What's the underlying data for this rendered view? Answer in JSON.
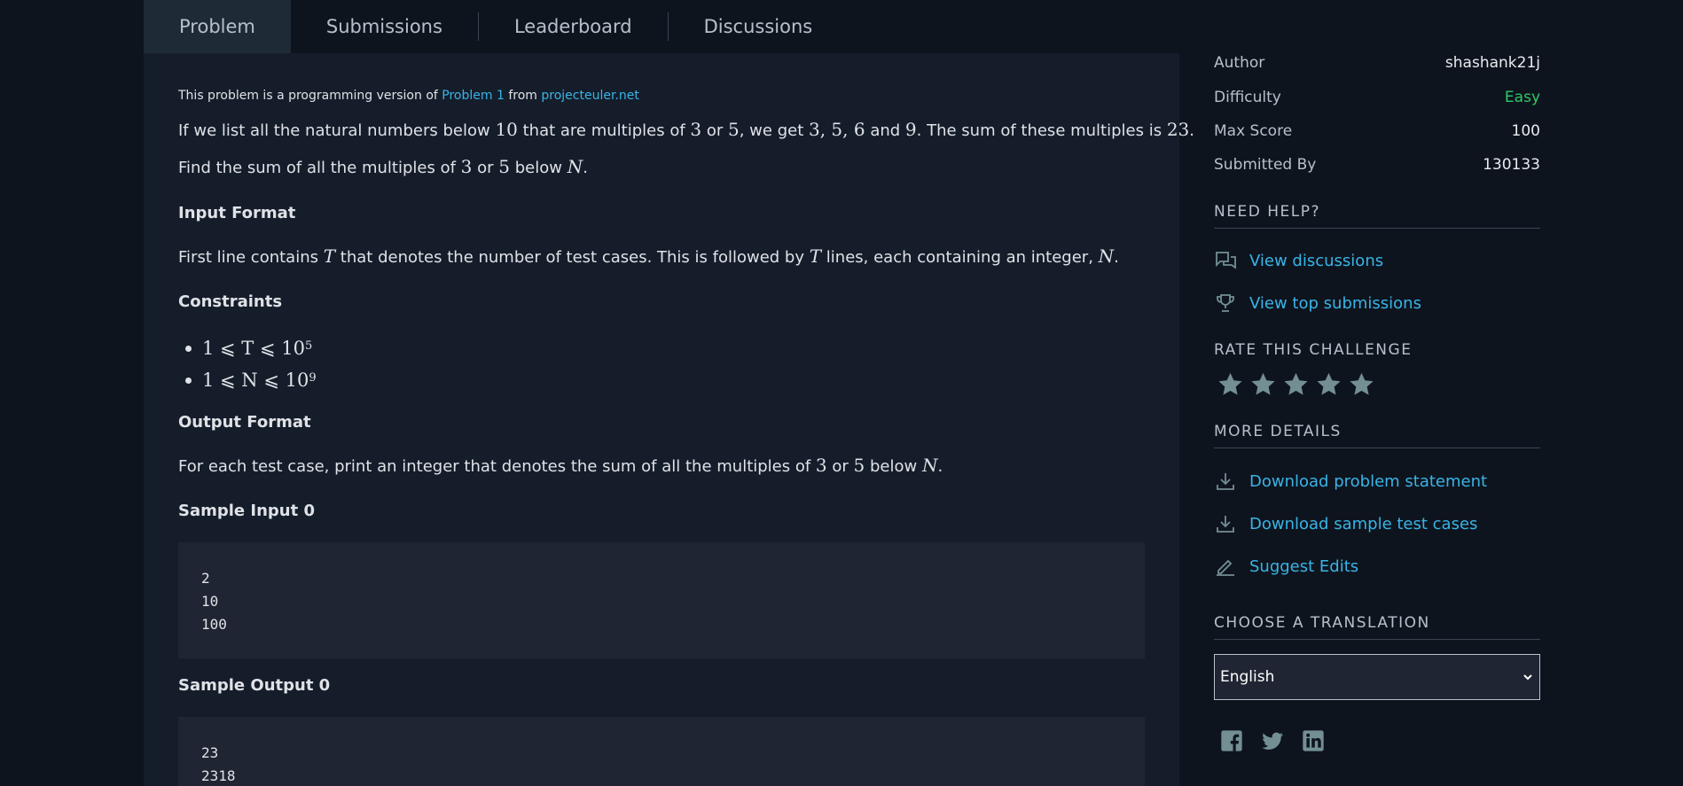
{
  "tabs": [
    {
      "label": "Problem"
    },
    {
      "label": "Submissions"
    },
    {
      "label": "Leaderboard"
    },
    {
      "label": "Discussions"
    }
  ],
  "source": {
    "prefix": "This problem is a programming version of ",
    "problem_link": "Problem 1",
    "middle": " from ",
    "site_link": "projecteuler.net"
  },
  "intro": {
    "p1_a": "If we list all the natural numbers below ",
    "p1_n1": "10",
    "p1_b": " that are multiples of ",
    "p1_n2": "3",
    "p1_c": " or ",
    "p1_n3": "5",
    "p1_d": ", we get ",
    "p1_n4": "3, 5, 6",
    "p1_e": " and ",
    "p1_n5": "9",
    "p1_f": ". The sum of these multiples is ",
    "p1_n6": "23",
    "p1_g": ".",
    "p2_a": "Find the sum of all the multiples of ",
    "p2_n1": "3",
    "p2_b": " or ",
    "p2_n2": "5",
    "p2_c": " below ",
    "p2_n3": "N",
    "p2_d": "."
  },
  "input_format": {
    "heading": "Input Format",
    "a": "First line contains ",
    "v1": "T",
    "b": " that denotes the number of test cases. This is followed by ",
    "v2": "T",
    "c": " lines, each containing an integer, ",
    "v3": "N",
    "d": "."
  },
  "constraints": {
    "heading": "Constraints",
    "items": [
      {
        "expr": "1 ⩽ T ⩽ 10",
        "exp": "5"
      },
      {
        "expr": "1 ⩽ N ⩽ 10",
        "exp": "9"
      }
    ]
  },
  "output_format": {
    "heading": "Output Format",
    "a": "For each test case, print an integer that denotes the sum of all the multiples of ",
    "n1": "3",
    "b": " or ",
    "n2": "5",
    "c": " below ",
    "v": "N",
    "d": "."
  },
  "sample_input": {
    "heading": "Sample Input 0",
    "lines": [
      "2",
      "10",
      "100"
    ]
  },
  "sample_output": {
    "heading": "Sample Output 0",
    "lines": [
      "23",
      "2318"
    ]
  },
  "sidebar": {
    "meta": [
      {
        "key": "Author",
        "value": "shashank21j"
      },
      {
        "key": "Difficulty",
        "value": "Easy"
      },
      {
        "key": "Max Score",
        "value": "100"
      },
      {
        "key": "Submitted By",
        "value": "130133"
      }
    ],
    "need_help": {
      "title": "NEED HELP?",
      "links": [
        {
          "label": "View discussions",
          "icon": "chat-icon"
        },
        {
          "label": "View top submissions",
          "icon": "trophy-icon"
        }
      ]
    },
    "rate": {
      "title": "RATE THIS CHALLENGE",
      "stars": 5
    },
    "more_details": {
      "title": "MORE DETAILS",
      "links": [
        {
          "label": "Download problem statement",
          "icon": "download-icon"
        },
        {
          "label": "Download sample test cases",
          "icon": "download-icon"
        },
        {
          "label": "Suggest Edits",
          "icon": "pencil-icon"
        }
      ]
    },
    "translation": {
      "title": "CHOOSE A TRANSLATION",
      "selected": "English"
    },
    "social": [
      "facebook-icon",
      "twitter-icon",
      "linkedin-icon"
    ]
  },
  "colors": {
    "background": "#0e141e",
    "panel": "#151d2b",
    "code_bg": "#1f2532",
    "link": "#39b4e6",
    "easy": "#2ec866",
    "icon_gray": "#738f93"
  }
}
